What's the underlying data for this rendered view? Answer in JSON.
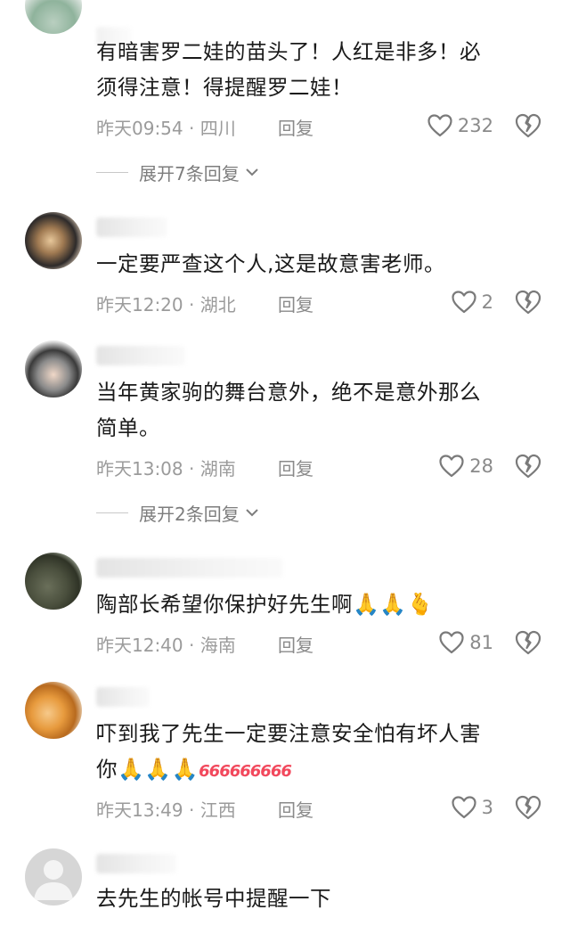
{
  "comments": [
    {
      "text_line1": "有暗害罗二娃的苗头了！人红是非多！必",
      "text_line2": "须得注意！得提醒罗二娃！",
      "time_location": "昨天09:54 · 四川",
      "reply_label": "回复",
      "likes": "232",
      "expand_label": "展开7条回复"
    },
    {
      "text_line1": "一定要严查这个人,这是故意害老师。",
      "time_location": "昨天12:20 · 湖北",
      "reply_label": "回复",
      "likes": "2"
    },
    {
      "text_line1": "当年黄家驹的舞台意外，绝不是意外那么",
      "text_line2": "简单。",
      "time_location": "昨天13:08 · 湖南",
      "reply_label": "回复",
      "likes": "28",
      "expand_label": "展开2条回复"
    },
    {
      "text_line1": "陶部长希望你保护好先生啊",
      "emojis": "🙏🙏🫰",
      "time_location": "昨天12:40 · 海南",
      "reply_label": "回复",
      "likes": "81"
    },
    {
      "text_line1": "吓到我了先生一定要注意安全怕有坏人害",
      "text_line2": "你",
      "emojis": "🙏🙏🙏",
      "badges": "666666666",
      "time_location": "昨天13:49 · 江西",
      "reply_label": "回复",
      "likes": "3"
    },
    {
      "text_line1": "去先生的帐号中提醒一下"
    }
  ],
  "icons": {
    "like": "heart-outline-icon",
    "dislike": "broken-heart-icon",
    "expand": "chevron-down-icon"
  },
  "colors": {
    "text": "#1a1a1a",
    "meta": "#9b9b9b",
    "icon": "#7a7a7a"
  }
}
